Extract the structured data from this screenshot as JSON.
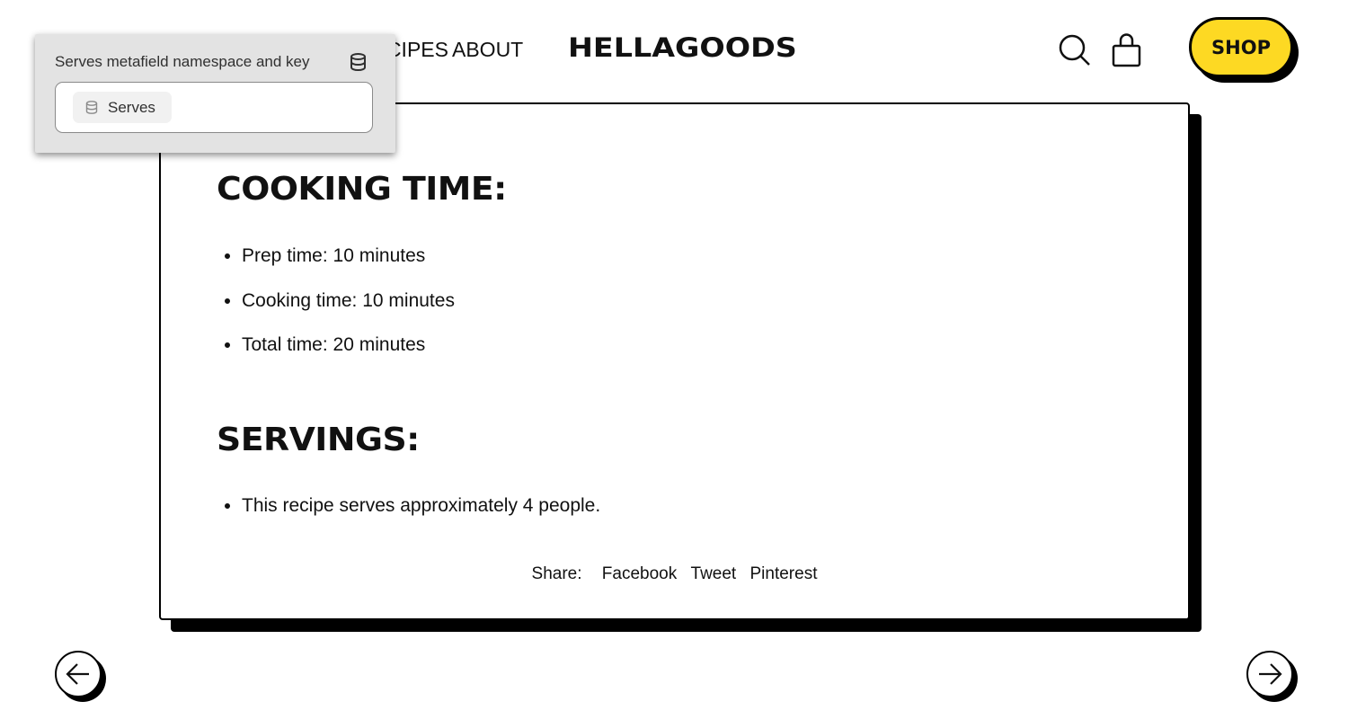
{
  "header": {
    "nav": [
      "RECIPES",
      "ABOUT"
    ],
    "logo": "HELLAGOODS",
    "shop_label": "SHOP",
    "icons": [
      "search-icon",
      "bag-icon"
    ],
    "accent": "#fdd923"
  },
  "card": {
    "cooking_heading": "COOKING TIME:",
    "cooking_items": [
      "Prep time: 10 minutes",
      "Cooking time: 10 minutes",
      "Total time: 20 minutes"
    ],
    "servings_heading": "SERVINGS:",
    "servings_items": [
      "This recipe serves approximately 4 people."
    ],
    "share_label": "Share:",
    "share_links": [
      "Facebook",
      "Tweet",
      "Pinterest"
    ]
  },
  "popup": {
    "label": "Serves metafield namespace and key",
    "chip": "Serves"
  }
}
